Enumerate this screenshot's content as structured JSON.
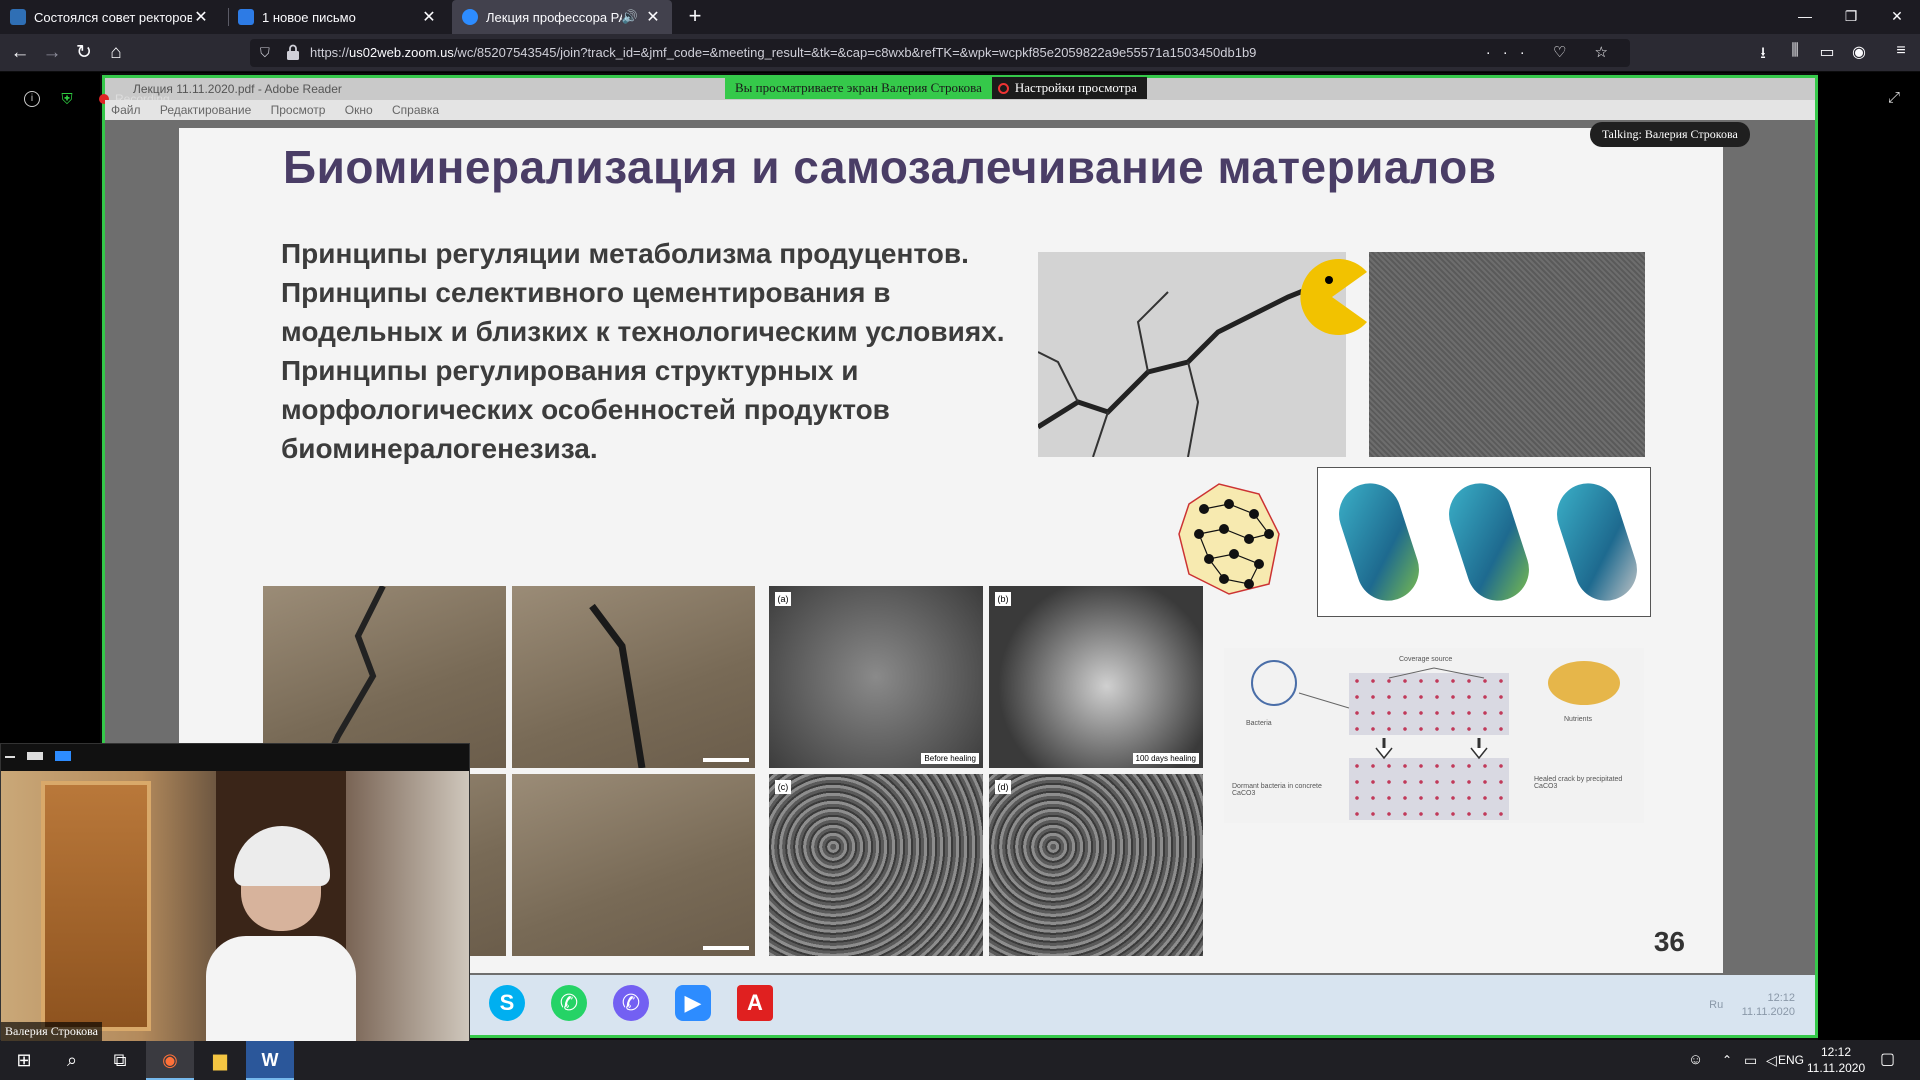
{
  "browser": {
    "tabs": [
      {
        "title": "Состоялся совет ректоров вуз",
        "favicon_color": "#2f6fb5"
      },
      {
        "title": "1 новое письмо",
        "favicon_color": "#2d7be5"
      },
      {
        "title": "Лекция профессора РАН",
        "favicon_color": "#2d8cff",
        "active": true,
        "audio": "🔊"
      }
    ],
    "new_tab": "+",
    "window_controls": [
      "—",
      "❐",
      "✕"
    ],
    "url_host": "us02web.zoom.us",
    "url_prefix": "https://",
    "url_path": "/wc/85207543545/join?track_id=&jmf_code=&meeting_result=&tk=&cap=c8wxb&refTK=&wpk=wcpkf85e2059822a9e55571a1503450db1b9",
    "nav": {
      "back": "←",
      "forward": "→",
      "reload": "↻",
      "home": "⌂"
    },
    "url_right_icons": "··· ♡ ☆",
    "toolbar_icons": [
      "⭳",
      "⫼",
      "▭",
      "◉",
      "≡"
    ]
  },
  "zoom": {
    "recording_label": "Recording",
    "share_banner_text": "Вы просматриваете экран Валерия Строкова",
    "share_options_label": "Настройки просмотра",
    "talking_label": "Talking: Валерия Строкова",
    "fullscreen_icon": "⤢",
    "participant_name": "Валерия Строкова"
  },
  "reader": {
    "title": "Лекция 11.11.2020.pdf - Adobe Reader",
    "menu": [
      "Файл",
      "Редактирование",
      "Просмотр",
      "Окно",
      "Справка"
    ]
  },
  "slide": {
    "title": "Биоминерализация и самозалечивание материалов",
    "bullets": [
      "Принципы регуляции метаболизма продуцентов.",
      "Принципы селективного  цементирования  в модельных и близких к технологическим условиях.",
      "Принципы регулирования структурных и морфологических особенностей продуктов биоминералогенезиза."
    ],
    "page_number": "36",
    "sem_labels": [
      "(a)",
      "(b)",
      "(c)",
      "(d)"
    ],
    "sem_captions": [
      "Before healing",
      "100 days healing"
    ],
    "diagram_labels": {
      "top": "Coverage source",
      "left": "Bacteria",
      "right": "Nutrients",
      "bottom_left": "Dormant bacteria in concrete CaCO3",
      "bottom_right": "Healed crack by precipitated CaCO3"
    }
  },
  "inner_taskbar": {
    "apps": [
      {
        "name": "skype",
        "glyph": "S",
        "color": "#00aff0"
      },
      {
        "name": "whatsapp",
        "glyph": "✆",
        "color": "#25d366"
      },
      {
        "name": "viber",
        "glyph": "✆",
        "color": "#7360f2"
      },
      {
        "name": "zoom",
        "glyph": "▶",
        "color": "#2d8cff"
      },
      {
        "name": "acrobat",
        "glyph": "A",
        "color": "#e02020"
      }
    ],
    "tray_lang": "Ru",
    "tray_time": "12:12",
    "tray_date": "11.11.2020"
  },
  "taskbar": {
    "icons": [
      "⊞",
      "⌕",
      "⧉",
      "◉",
      "▆",
      "W"
    ],
    "tray_lang": "ENG",
    "time": "12:12",
    "date": "11.11.2020",
    "notification_icon": "▢"
  }
}
